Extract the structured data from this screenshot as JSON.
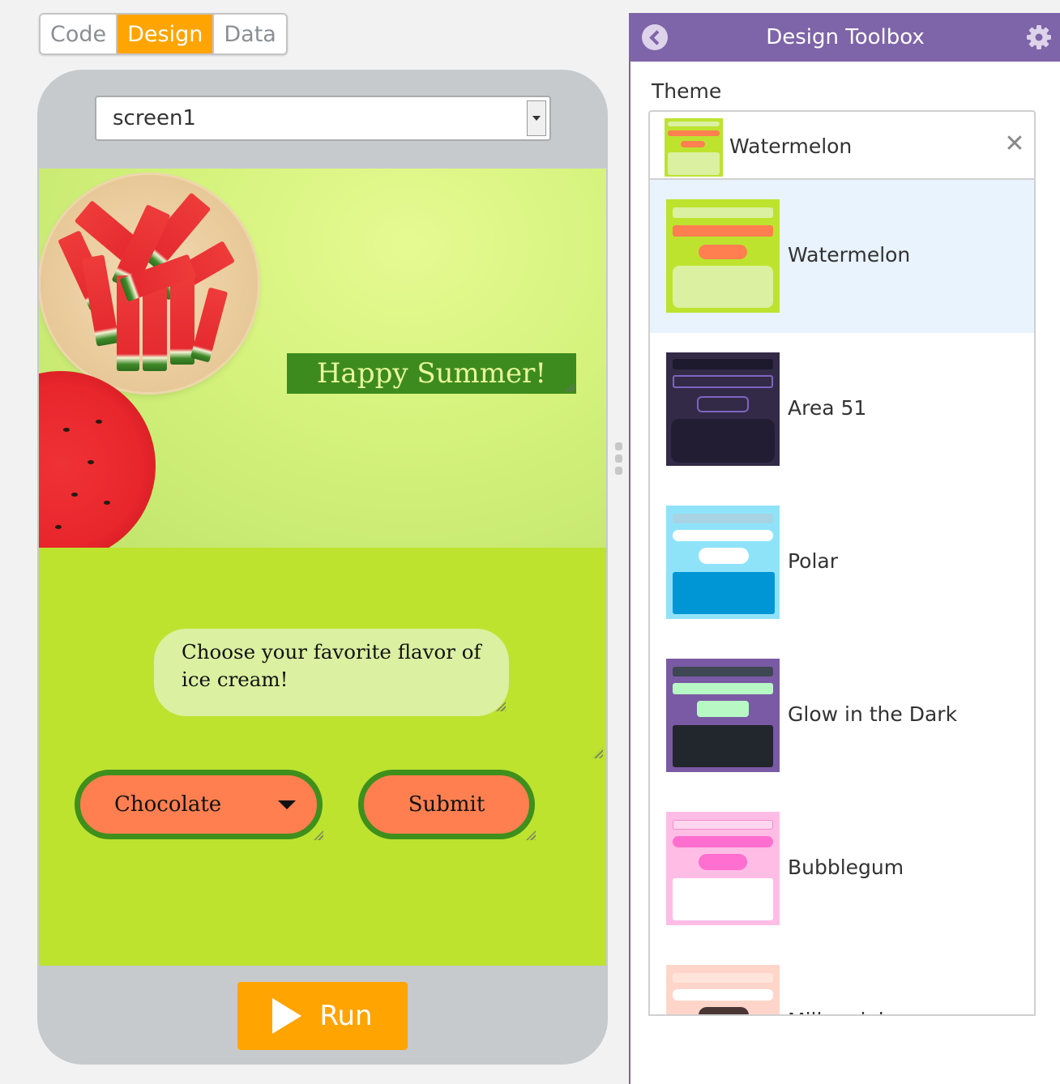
{
  "mode_tabs": [
    {
      "label": "Code",
      "active": false
    },
    {
      "label": "Design",
      "active": true
    },
    {
      "label": "Data",
      "active": false
    }
  ],
  "screen_selector": {
    "value": "screen1"
  },
  "app": {
    "title": "Happy Summer!",
    "prompt": "Choose your favorite flavor of ice cream!",
    "dropdown_value": "Chocolate",
    "submit_label": "Submit"
  },
  "run_label": "Run",
  "toolbox": {
    "title": "Design Toolbox",
    "theme_label": "Theme",
    "selected_theme": "Watermelon",
    "themes": [
      {
        "name": "Watermelon",
        "bg": "#bde32f",
        "bar": "#dbf0a0",
        "dropdown": "#ff7f50",
        "button": "#ff7f50",
        "panel": "#dbf0a0",
        "selected": true
      },
      {
        "name": "Area 51",
        "bg": "#332a48",
        "bar": "#1e1a2e",
        "dropdown": "#332a48",
        "button": "#332a48",
        "panel": "#221d33",
        "selected": false
      },
      {
        "name": "Polar",
        "bg": "#8fe3f9",
        "bar": "#a7d3e3",
        "dropdown": "#ffffff",
        "button": "#ffffff",
        "panel": "#0096d6",
        "selected": false
      },
      {
        "name": "Glow in the Dark",
        "bg": "#7a5aa4",
        "bar": "#3e4752",
        "dropdown": "#b7f8c5",
        "button": "#b7f8c5",
        "panel": "#22262d",
        "selected": false
      },
      {
        "name": "Bubblegum",
        "bg": "#ffbde6",
        "bar": "#ffd6ef",
        "dropdown": "#ff6fcf",
        "button": "#ff6fcf",
        "panel": "#ffffff",
        "selected": false
      },
      {
        "name": "Millennial",
        "bg": "#ffd5c9",
        "bar": "#ffe4da",
        "dropdown": "#ffffff",
        "button": "#4a3535",
        "panel": "#ffffff",
        "selected": false
      }
    ]
  },
  "colors": {
    "accent": "#ffa400",
    "toolbox_header": "#7e64a8",
    "app_background": "#bde32f",
    "button_fill": "#ff7f50",
    "button_border": "#3f8f1c"
  }
}
